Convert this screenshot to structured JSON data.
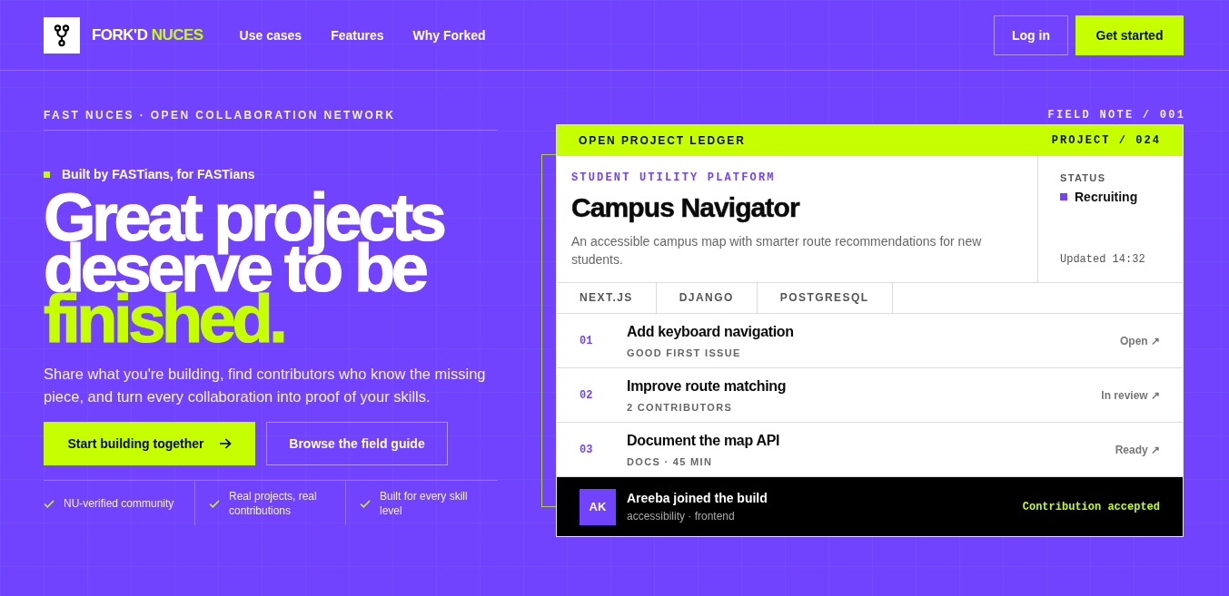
{
  "header": {
    "brand": "FORK'D",
    "brand_accent": "NUCES",
    "nav": [
      "Use cases",
      "Features",
      "Why Forked"
    ],
    "login": "Log in",
    "cta": "Get started"
  },
  "hero": {
    "eyebrow": "FAST NUCES · OPEN COLLABORATION NETWORK",
    "tagline": "Built by FASTians, for FASTians",
    "headline": "Great projects deserve to be",
    "headline_accent": "finished.",
    "description": "Share what you're building, find contributors who know the missing piece, and turn every collaboration into proof of your skills.",
    "buttons": [
      {
        "label": "Start building together",
        "kind": "primary"
      },
      {
        "label": "Browse the field guide",
        "kind": "secondary"
      }
    ],
    "features": [
      "NU-verified community",
      "Real projects, real contributions",
      "Built for every skill level"
    ]
  },
  "ledger": {
    "note": "FIELD NOTE / 001",
    "title": "OPEN PROJECT LEDGER",
    "project": "PROJECT / 024",
    "category": "STUDENT UTILITY PLATFORM",
    "name": "Campus Navigator",
    "description": "An accessible campus map with smarter route recommendations for new students.",
    "status_label": "STATUS",
    "status": "Recruiting",
    "updated": "Updated 14:32",
    "tags": [
      "NEXT.JS",
      "DJANGO",
      "POSTGRESQL"
    ],
    "tasks": [
      {
        "number": "01",
        "title": "Add keyboard navigation",
        "meta": "GOOD FIRST ISSUE",
        "status": "Open ↗"
      },
      {
        "number": "02",
        "title": "Improve route matching",
        "meta": "2 CONTRIBUTORS",
        "status": "In review ↗"
      },
      {
        "number": "03",
        "title": "Document the map API",
        "meta": "DOCS · 45 MIN",
        "status": "Ready ↗"
      }
    ],
    "activity": {
      "initials": "AK",
      "title": "Areeba joined the build",
      "meta": "accessibility · frontend",
      "result": "Contribution accepted"
    }
  }
}
